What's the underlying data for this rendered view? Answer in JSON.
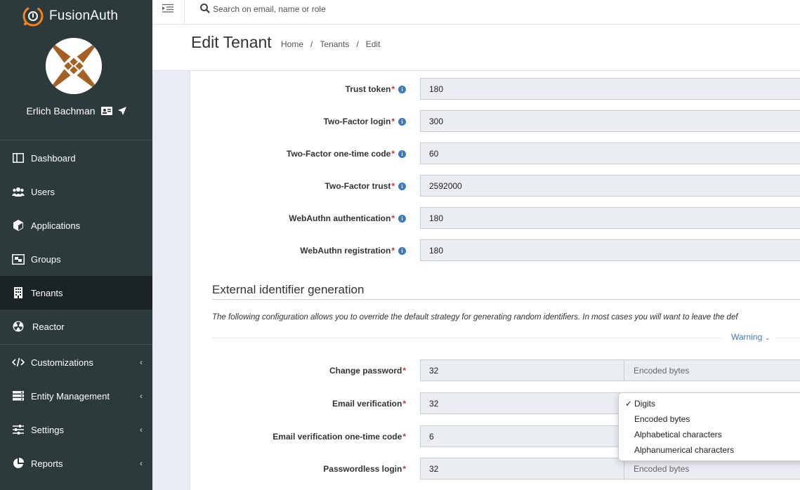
{
  "brand": {
    "name": "FusionAuth"
  },
  "user": {
    "name": "Erlich Bachman"
  },
  "sidebar": {
    "items": [
      {
        "label": "Dashboard",
        "icon": "dashboard-icon",
        "active": false,
        "expandable": false
      },
      {
        "label": "Users",
        "icon": "users-icon",
        "active": false,
        "expandable": false
      },
      {
        "label": "Applications",
        "icon": "cube-icon",
        "active": false,
        "expandable": false
      },
      {
        "label": "Groups",
        "icon": "groups-icon",
        "active": false,
        "expandable": false
      },
      {
        "label": "Tenants",
        "icon": "building-icon",
        "active": true,
        "expandable": false
      },
      {
        "label": "Reactor",
        "icon": "reactor-icon",
        "active": false,
        "expandable": false
      },
      {
        "label": "Customizations",
        "icon": "code-icon",
        "active": false,
        "expandable": true
      },
      {
        "label": "Entity Management",
        "icon": "server-icon",
        "active": false,
        "expandable": true
      },
      {
        "label": "Settings",
        "icon": "sliders-icon",
        "active": false,
        "expandable": true
      },
      {
        "label": "Reports",
        "icon": "pie-chart-icon",
        "active": false,
        "expandable": true
      }
    ]
  },
  "search": {
    "placeholder": "Search on email, name or role"
  },
  "header": {
    "title": "Edit Tenant",
    "breadcrumbs": [
      "Home",
      "Tenants",
      "Edit"
    ]
  },
  "ttl_fields": [
    {
      "label": "Trust token",
      "value": "180"
    },
    {
      "label": "Two-Factor login",
      "value": "300"
    },
    {
      "label": "Two-Factor one-time code",
      "value": "60"
    },
    {
      "label": "Two-Factor trust",
      "value": "2592000"
    },
    {
      "label": "WebAuthn authentication",
      "value": "180"
    },
    {
      "label": "WebAuthn registration",
      "value": "180"
    }
  ],
  "external": {
    "title": "External identifier generation",
    "description": "The following configuration allows you to override the default strategy for generating random identifiers. In most cases you will want to leave the def",
    "warning_label": "Warning",
    "fields": [
      {
        "label": "Change password",
        "value": "32",
        "type": "Encoded bytes"
      },
      {
        "label": "Email verification",
        "value": "32",
        "type": "Digits"
      },
      {
        "label": "Email verification one-time code",
        "value": "6",
        "type": ""
      },
      {
        "label": "Passwordless login",
        "value": "32",
        "type": "Encoded bytes"
      }
    ]
  },
  "dropdown": {
    "selected": "Digits",
    "options": [
      "Digits",
      "Encoded bytes",
      "Alphabetical characters",
      "Alphanumerical characters"
    ]
  },
  "colors": {
    "sidebar": "#2c3a3c",
    "sidebar_active": "#1b2324",
    "accent": "#3c79c4",
    "brand_orange": "#f58320",
    "required": "#c0392b"
  }
}
